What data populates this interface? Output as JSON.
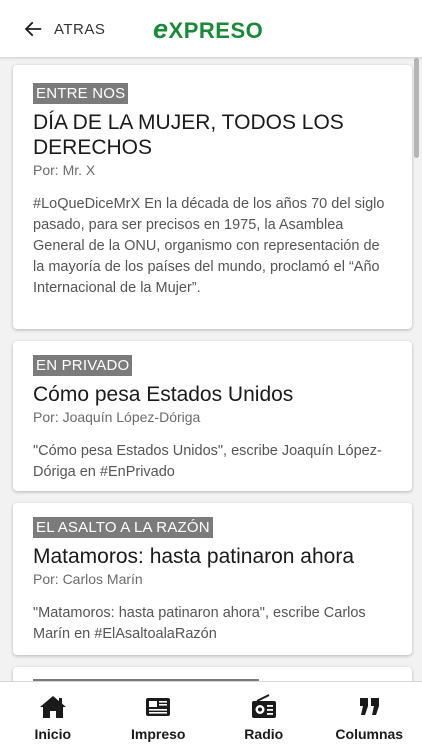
{
  "header": {
    "back_label": "ATRAS",
    "logo_e": "e",
    "logo_rest": "XPRESO"
  },
  "articles": [
    {
      "section": "ENTRE NOS",
      "title": "DÍA DE LA MUJER, TODOS LOS DERECHOS",
      "author": "Por: Mr. X",
      "summary": "#LoQueDiceMrX En la década de los años 70 del siglo pasado, para ser precisos en 1975, la Asamblea General de la ONU, organismo con representación de la mayoría de los países del mundo, proclamó el “Año Internacional de la Mujer”."
    },
    {
      "section": "EN PRIVADO",
      "title": "Cómo pesa Estados Unidos",
      "author": "Por: Joaquín López-Dóriga",
      "summary": "\"Cómo pesa Estados Unidos\", escribe Joaquín López-Dóriga en #EnPrivado"
    },
    {
      "section": "EL ASALTO A LA RAZÓN",
      "title": "Matamoros: hasta patinaron ahora",
      "author": "Por: Carlos Marín",
      "summary": "\"Matamoros: hasta patinaron ahora\", escribe Carlos Marín en #ElAsaltoalaRazón"
    }
  ],
  "tabs": [
    {
      "label": "Inicio",
      "icon": "home-icon"
    },
    {
      "label": "Impreso",
      "icon": "newspaper-icon"
    },
    {
      "label": "Radio",
      "icon": "radio-icon"
    },
    {
      "label": "Columnas",
      "icon": "quote-icon"
    }
  ],
  "colors": {
    "logo_green": "#1a8a3a",
    "badge_gray": "#7b7b7b"
  }
}
